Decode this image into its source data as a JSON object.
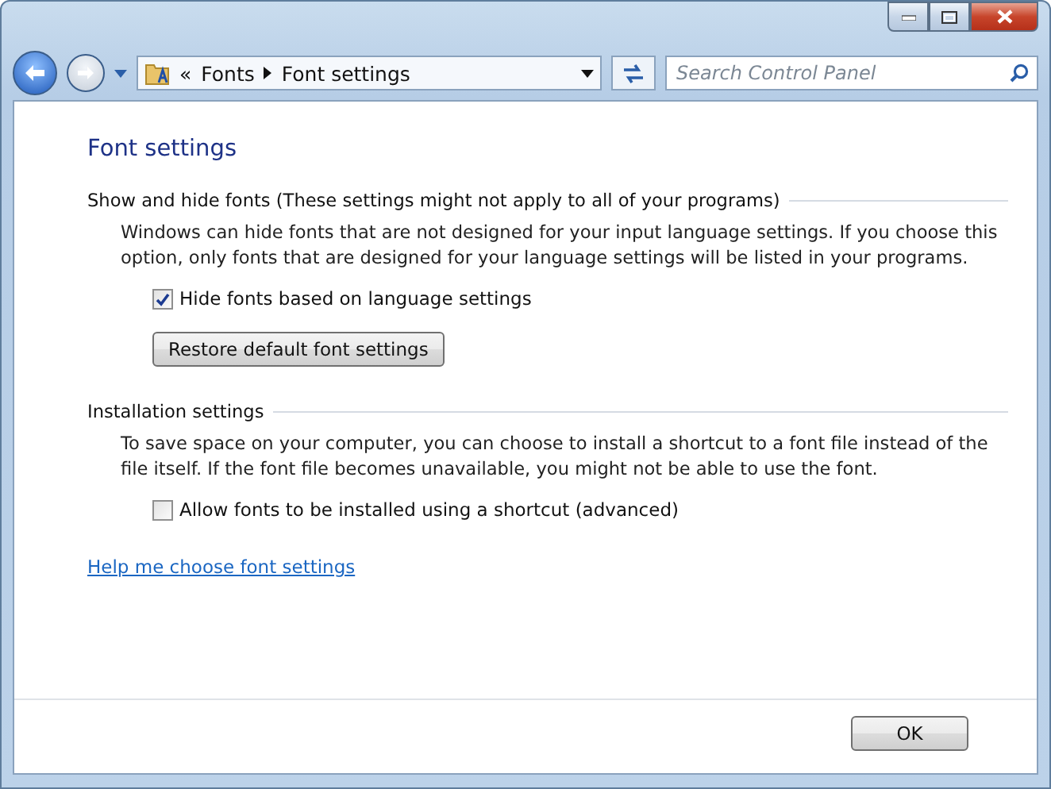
{
  "window": {
    "controls": [
      {
        "kind": "minimize"
      },
      {
        "kind": "maximize"
      },
      {
        "kind": "close"
      }
    ]
  },
  "address_bar": {
    "overflow": "«",
    "crumbs": [
      "Fonts",
      "Font settings"
    ]
  },
  "search": {
    "placeholder": "Search Control Panel"
  },
  "page": {
    "title": "Font settings",
    "sections": [
      {
        "heading": "Show and hide fonts (These settings might not apply to all of your programs)",
        "description": "Windows can hide fonts that are not designed for your input language settings. If you choose this option, only fonts that are designed for your language settings will be listed in your programs.",
        "checkbox": {
          "label": "Hide fonts based on language settings",
          "checked": true
        },
        "button": "Restore default font settings"
      },
      {
        "heading": "Installation settings",
        "description": "To save space on your computer, you can choose to install a shortcut to a font file instead of the file itself. If the font file becomes unavailable, you might not be able to use the font.",
        "checkbox": {
          "label": "Allow fonts to be installed using a shortcut (advanced)",
          "checked": false
        }
      }
    ],
    "link": "Help me choose font settings"
  },
  "buttons": [
    "OK"
  ]
}
